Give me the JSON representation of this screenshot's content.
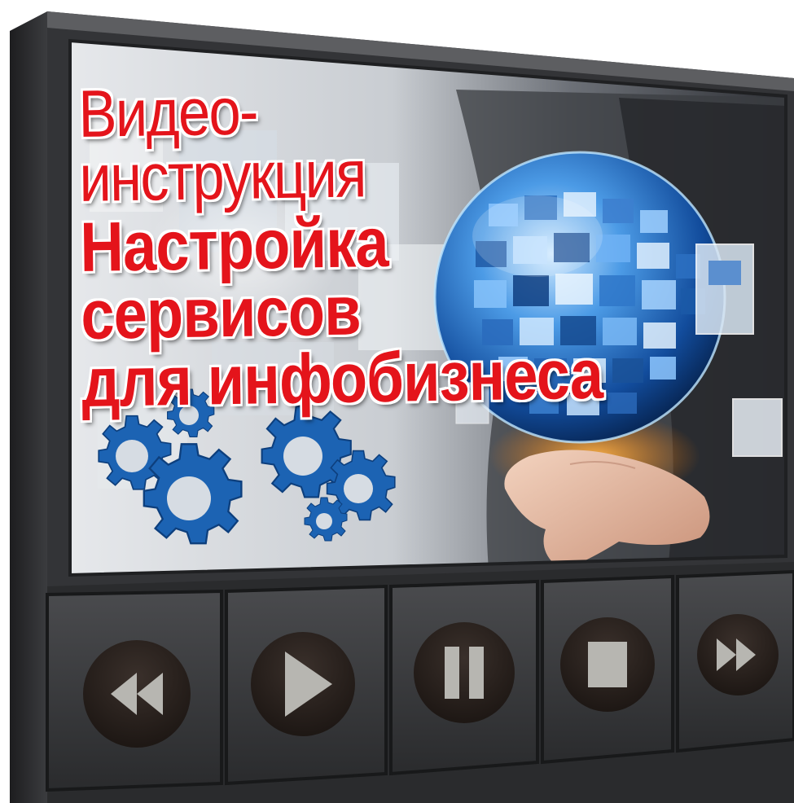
{
  "title": {
    "line1": "Видео-инструкция",
    "line2": "Настройка",
    "line3": "сервисов",
    "line4": "для инфобизнеса"
  },
  "colors": {
    "headline": "#e4141b",
    "frame": "#3a3b3d",
    "gear": "#1c63b3",
    "button_circle": "#2b2320",
    "button_glyph": "#b7b6b1"
  },
  "controls": [
    {
      "name": "rewind-button",
      "icon": "rewind-icon"
    },
    {
      "name": "play-button",
      "icon": "play-icon"
    },
    {
      "name": "pause-button",
      "icon": "pause-icon"
    },
    {
      "name": "stop-button",
      "icon": "stop-icon"
    },
    {
      "name": "fast-forward-button",
      "icon": "fast-forward-icon"
    }
  ]
}
